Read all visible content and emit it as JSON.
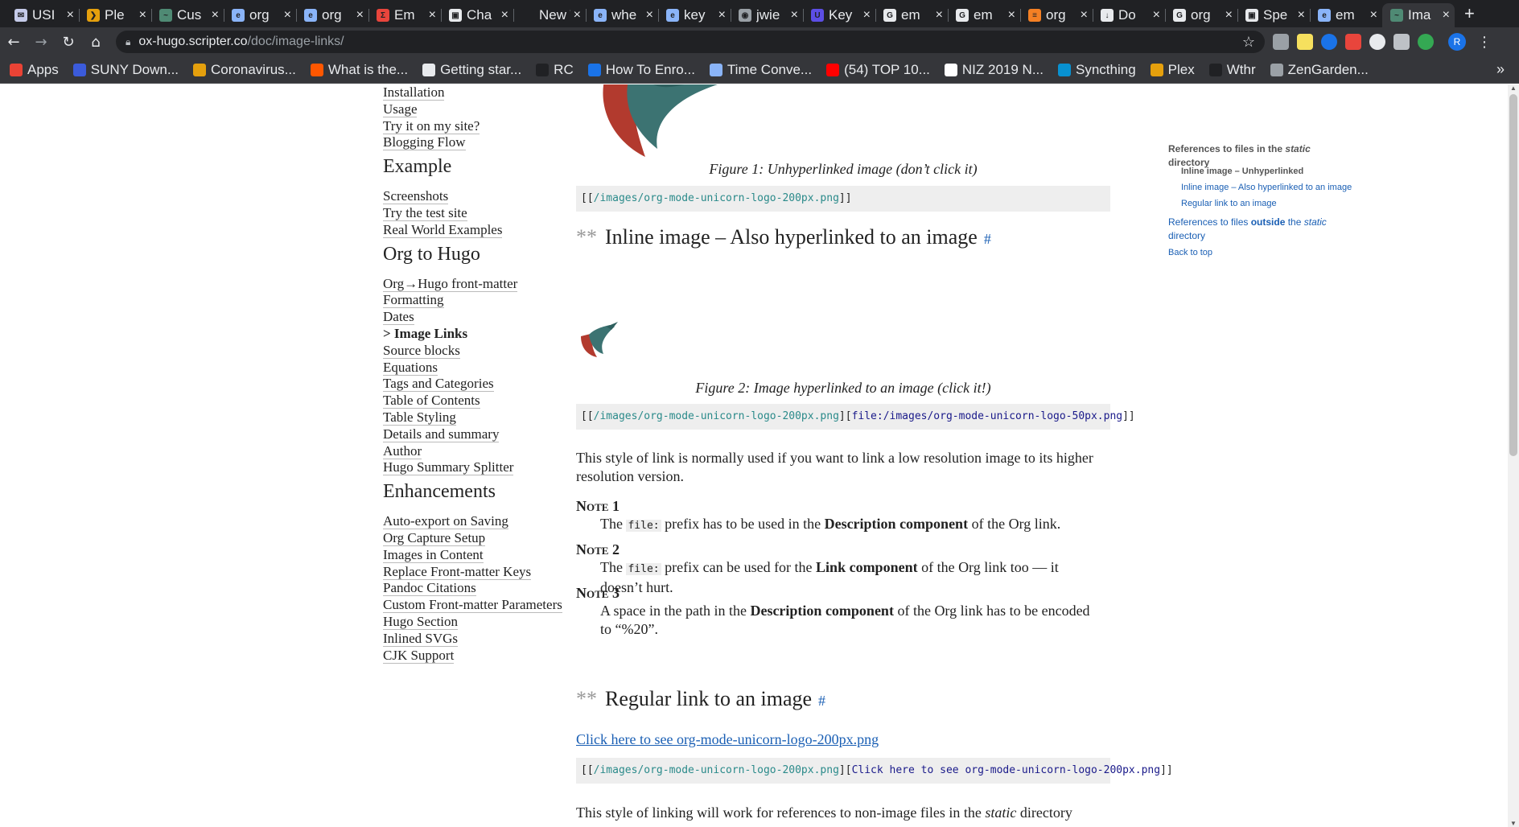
{
  "browser": {
    "tabs": [
      {
        "label": "USI",
        "color": "#c5cbe9",
        "glyph": "✉"
      },
      {
        "label": "Ple",
        "color": "#e5a00d",
        "glyph": "❯"
      },
      {
        "label": "Cus",
        "color": "#4f8a74",
        "glyph": "~"
      },
      {
        "label": "org",
        "color": "#8ab4f8",
        "glyph": "e"
      },
      {
        "label": "org",
        "color": "#8ab4f8",
        "glyph": "e"
      },
      {
        "label": "Em",
        "color": "#e8453c",
        "glyph": "Σ"
      },
      {
        "label": "Cha",
        "color": "#e8eaed",
        "glyph": "▣"
      },
      {
        "label": "New T",
        "color": "#202124",
        "glyph": ""
      },
      {
        "label": "whe",
        "color": "#8ab4f8",
        "glyph": "e"
      },
      {
        "label": "key",
        "color": "#8ab4f8",
        "glyph": "e"
      },
      {
        "label": "jwie",
        "color": "#9aa0a6",
        "glyph": "◉"
      },
      {
        "label": "Key",
        "color": "#5c4ee5",
        "glyph": "U"
      },
      {
        "label": "em",
        "color": "#e8eaed",
        "glyph": "G"
      },
      {
        "label": "em",
        "color": "#e8eaed",
        "glyph": "G"
      },
      {
        "label": "org",
        "color": "#f48024",
        "glyph": "≡"
      },
      {
        "label": "Do",
        "color": "#e8eaed",
        "glyph": "↓"
      },
      {
        "label": "org",
        "color": "#e8eaed",
        "glyph": "G"
      },
      {
        "label": "Spe",
        "color": "#e8eaed",
        "glyph": "▣"
      },
      {
        "label": "em",
        "color": "#8ab4f8",
        "glyph": "e"
      },
      {
        "label": "Ima",
        "color": "#4f8a74",
        "glyph": "~"
      }
    ],
    "active_tab_index": 19,
    "close_glyph": "×",
    "new_tab_glyph": "+",
    "url_host": "ox-hugo.scripter.co",
    "url_path": "/doc/image-links/",
    "profile_initial": "R",
    "bookmarks": [
      {
        "label": "Apps",
        "color": "#ea4335"
      },
      {
        "label": "SUNY Down...",
        "color": "#3b5bdb"
      },
      {
        "label": "Coronavirus...",
        "color": "#e5a00d"
      },
      {
        "label": "What is the...",
        "color": "#ff5700"
      },
      {
        "label": "Getting star...",
        "color": "#e8eaed"
      },
      {
        "label": "RC",
        "color": "#202124"
      },
      {
        "label": "How To Enro...",
        "color": "#1a73e8"
      },
      {
        "label": "Time Conve...",
        "color": "#8ab4f8"
      },
      {
        "label": "(54) TOP 10...",
        "color": "#ff0000"
      },
      {
        "label": "NIZ 2019 N...",
        "color": "#ffffff"
      },
      {
        "label": "Syncthing",
        "color": "#0891d1"
      },
      {
        "label": "Plex",
        "color": "#e5a00d"
      },
      {
        "label": "Wthr",
        "color": "#202124"
      },
      {
        "label": "ZenGarden...",
        "color": "#9aa0a6"
      }
    ],
    "bookmarks_more": "»"
  },
  "sidenav": {
    "items": [
      {
        "type": "link",
        "label": "Installation"
      },
      {
        "type": "link",
        "label": "Usage"
      },
      {
        "type": "link",
        "label": "Try it on my site?"
      },
      {
        "type": "link",
        "label": "Blogging Flow"
      },
      {
        "type": "heading",
        "label": "Example"
      },
      {
        "type": "link",
        "label": "Screenshots"
      },
      {
        "type": "link",
        "label": "Try the test site"
      },
      {
        "type": "link",
        "label": "Real World Examples"
      },
      {
        "type": "heading",
        "label": "Org to Hugo"
      },
      {
        "type": "link",
        "label": "Org→Hugo front-matter"
      },
      {
        "type": "link",
        "label": "Formatting"
      },
      {
        "type": "link",
        "label": "Dates"
      },
      {
        "type": "active",
        "label": "> Image Links"
      },
      {
        "type": "link",
        "label": "Source blocks"
      },
      {
        "type": "link",
        "label": "Equations"
      },
      {
        "type": "link",
        "label": "Tags and Categories"
      },
      {
        "type": "link",
        "label": "Table of Contents"
      },
      {
        "type": "link",
        "label": "Table Styling"
      },
      {
        "type": "link",
        "label": "Details and summary"
      },
      {
        "type": "link",
        "label": "Author"
      },
      {
        "type": "link",
        "label": "Hugo Summary Splitter"
      },
      {
        "type": "heading",
        "label": "Enhancements"
      },
      {
        "type": "link",
        "label": "Auto-export on Saving"
      },
      {
        "type": "link",
        "label": "Org Capture Setup"
      },
      {
        "type": "link",
        "label": "Images in Content"
      },
      {
        "type": "link",
        "label": "Replace Front-matter Keys"
      },
      {
        "type": "link",
        "label": "Pandoc Citations"
      },
      {
        "type": "link",
        "label": "Custom Front-matter Parameters"
      },
      {
        "type": "link",
        "label": "Hugo Section"
      },
      {
        "type": "link",
        "label": "Inlined SVGs"
      },
      {
        "type": "link",
        "label": "CJK Support"
      }
    ]
  },
  "main": {
    "figure1_caption": "Figure 1: Unhyperlinked image (don’t click it)",
    "code1": {
      "open": "[[",
      "link": "/images/org-mode-unicorn-logo-200px.png",
      "close": "]]"
    },
    "h_inline": {
      "stars": "**",
      "title": "Inline image – Also hyperlinked to an image",
      "anchor": "#"
    },
    "figure2_caption": "Figure 2: Image hyperlinked to an image (click it!)",
    "code2": {
      "open": "[[",
      "link": "/images/org-mode-unicorn-logo-200px.png",
      "mid": "][",
      "desc": "file:/images/org-mode-unicorn-logo-50px.png",
      "close": "]]"
    },
    "para1": "This style of link is normally used if you want to link a low resolution image to its higher resolution version.",
    "notes": [
      {
        "term": "Note 1",
        "pre": "The ",
        "code": "file:",
        "mid": " prefix has to be used in the ",
        "bold": "Description component",
        "post": " of the Org link."
      },
      {
        "term": "Note 2",
        "pre": "The ",
        "code": "file:",
        "mid": " prefix can be used for the ",
        "bold": "Link component",
        "post": " of the Org link too — it doesn’t hurt."
      },
      {
        "term": "Note 3",
        "pre": "A space in the path in the ",
        "code": "",
        "mid": "",
        "bold": "Description component",
        "post": " of the Org link has to be encoded to “%20”."
      }
    ],
    "h_regular": {
      "stars": "**",
      "title": "Regular link to an image",
      "anchor": "#"
    },
    "regular_link": "Click here to see org-mode-unicorn-logo-200px.png",
    "code3": {
      "open": "[[",
      "link": "/images/org-mode-unicorn-logo-200px.png",
      "mid": "][",
      "desc": "Click here to see org-mode-unicorn-logo-200px.png",
      "close": "]]"
    },
    "para2_pre": "This style of linking will work for references to non-image files in the ",
    "para2_em": "static",
    "para2_post": " directory"
  },
  "toc": {
    "current_pre": "References to files in the ",
    "current_em": "static",
    "current_post": " directory",
    "sub1": "Inline image – Unhyperlinked",
    "sub2": "Inline image – Also hyperlinked to an image",
    "sub3": "Regular link to an image",
    "outside_pre": "References to files ",
    "outside_bold": "outside",
    "outside_mid": " the ",
    "outside_em": "static",
    "outside_post": " directory",
    "back_to_top": "Back to top"
  }
}
